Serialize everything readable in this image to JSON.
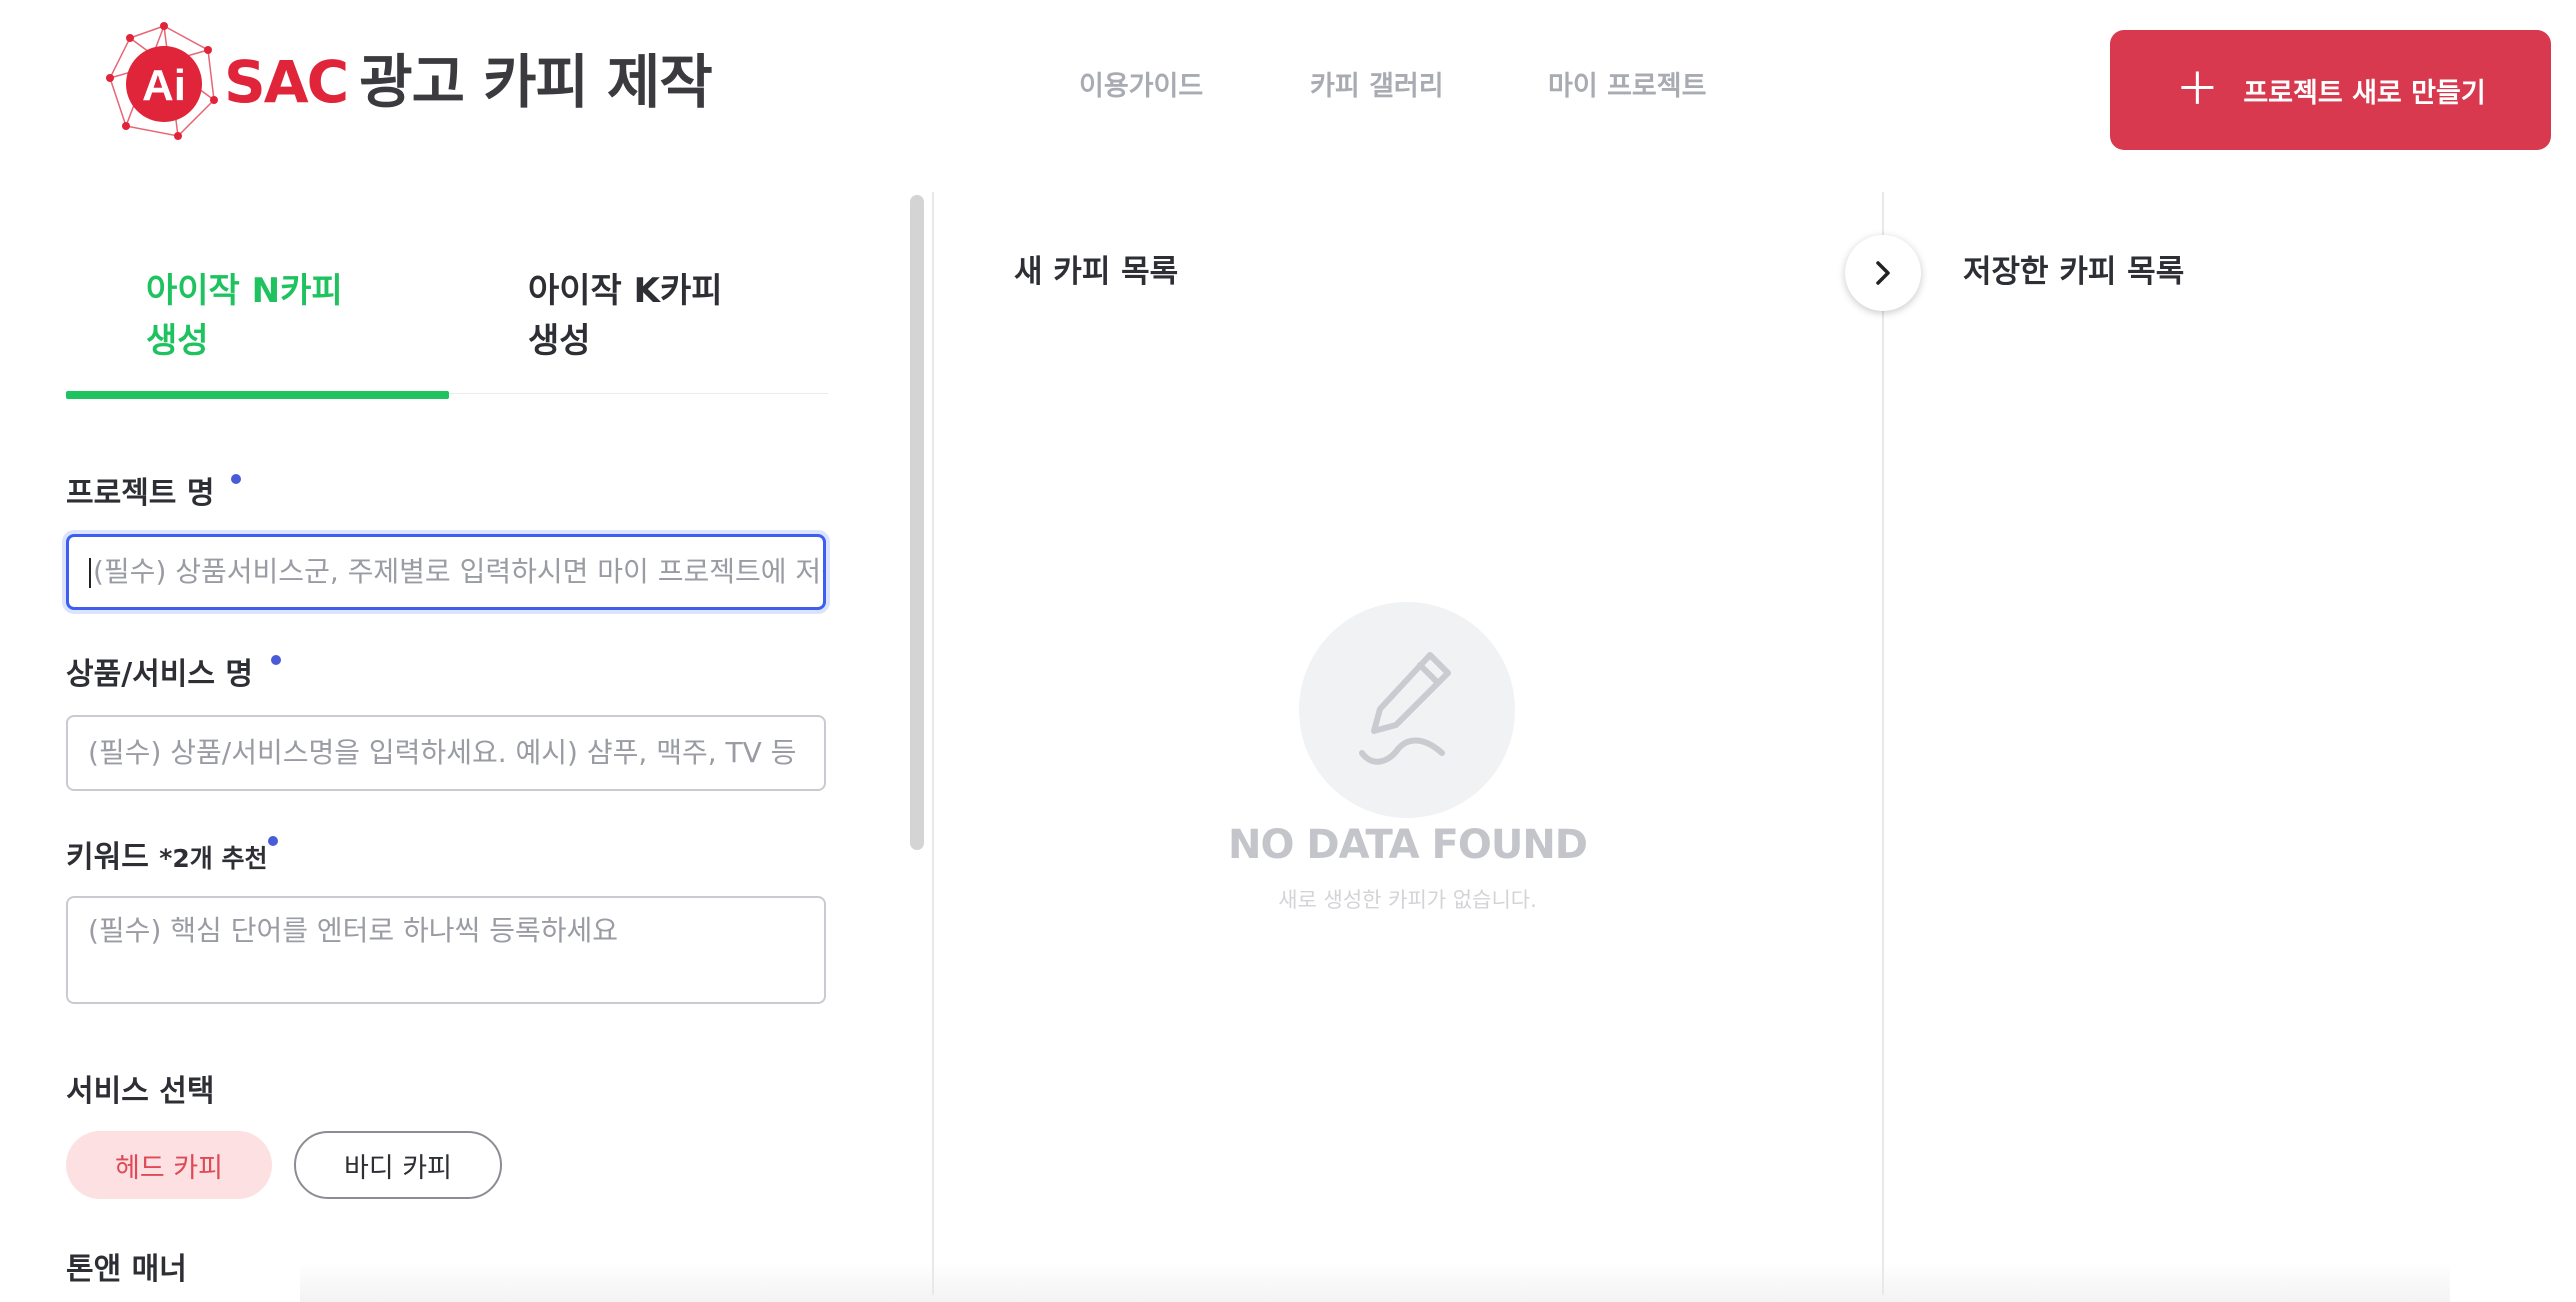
{
  "header": {
    "logo_brand": "SAC",
    "logo_title": "광고 카피 제작",
    "logo_mark_text": "Ai",
    "nav": [
      "이용가이드",
      "카피 갤러리",
      "마이 프로젝트"
    ],
    "new_project_label": "프로젝트 새로 만들기",
    "accent_color": "#d8394f"
  },
  "tabs": {
    "n_copy": "아이작 N카피\n생성",
    "k_copy": "아이작 K카피\n생성",
    "active": "n_copy",
    "active_color": "#1ec25e"
  },
  "form": {
    "project_name": {
      "label": "프로젝트 명",
      "placeholder": "(필수) 상품서비스군, 주제별로 입력하시면 마이 프로젝트에 저장됩니다"
    },
    "product_name": {
      "label": "상품/서비스 명",
      "placeholder": "(필수) 상품/서비스명을 입력하세요. 예시) 샴푸, 맥주, TV 등"
    },
    "keyword": {
      "label": "키워드",
      "note": "*2개 추천",
      "placeholder": "(필수) 핵심 단어를 엔터로 하나씩 등록하세요"
    },
    "service": {
      "label": "서비스 선택",
      "options": [
        "헤드 카피",
        "바디 카피"
      ],
      "selected": "헤드 카피"
    },
    "tone": {
      "label": "톤앤 매너"
    }
  },
  "panels": {
    "new_copies_title": "새 카피 목록",
    "saved_copies_title": "저장한 카피 목록",
    "empty_title": "NO DATA FOUND",
    "empty_subtitle": "새로 생성한 카피가 없습니다."
  },
  "icons": {
    "new_project": "plus-icon",
    "expand": "chevron-right-icon",
    "empty": "pencil-icon"
  }
}
